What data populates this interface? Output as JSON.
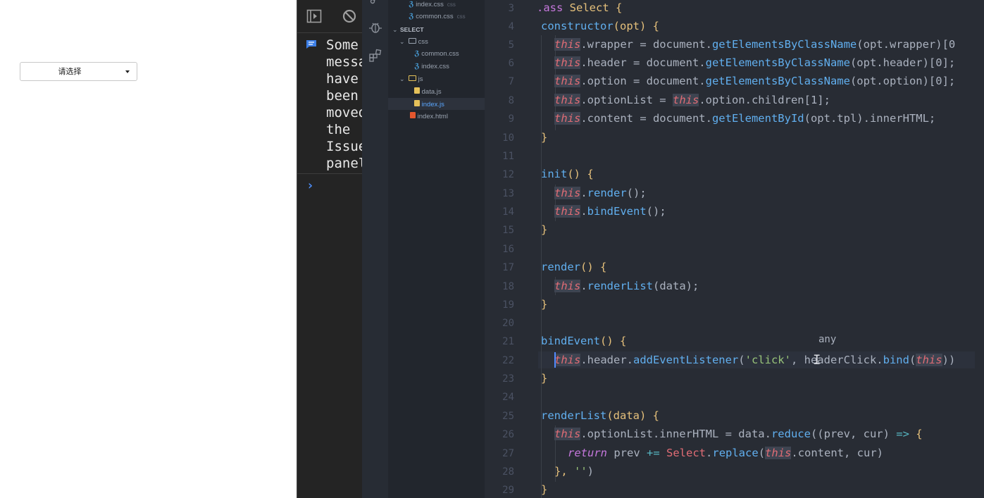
{
  "page": {
    "select": {
      "placeholder_label": "请选择"
    }
  },
  "devtools": {
    "toolbar": {
      "icons": [
        "console-sidebar-icon",
        "clear-console-icon"
      ]
    },
    "message": {
      "icon": "message-icon",
      "text": "Some messages have been moved the Issues panel"
    },
    "prompt": "›"
  },
  "explorer": {
    "rows": [
      {
        "label": "index.css",
        "sub": "css",
        "icon": "css-icon"
      },
      {
        "label": "common.css",
        "sub": "css",
        "icon": "css-icon"
      },
      {
        "label": "SELECT",
        "icon": "chevron-down-icon"
      },
      {
        "label": "css",
        "icon": "folder-icon"
      },
      {
        "label": "common.css",
        "icon": "css-icon"
      },
      {
        "label": "index.css",
        "icon": "css-icon"
      },
      {
        "label": "js",
        "icon": "folder-icon"
      },
      {
        "label": "data.js",
        "icon": "js-icon"
      },
      {
        "label": "index.js",
        "icon": "js-icon"
      },
      {
        "label": "index.html",
        "icon": "html-icon"
      }
    ]
  },
  "editor": {
    "line_numbers": [
      "3",
      "4",
      "5",
      "6",
      "7",
      "8",
      "9",
      "10",
      "11",
      "12",
      "13",
      "14",
      "15",
      "16",
      "17",
      "18",
      "19",
      "20",
      "21",
      "22",
      "23",
      "24",
      "25",
      "26",
      "27",
      "28",
      "29"
    ],
    "tooltip": "any",
    "code": {
      "l3": {
        "a": ".ass ",
        "b": "Select",
        "c": " {"
      },
      "l4": {
        "a": "constructor",
        "b": "(opt) {"
      },
      "l5": {
        "a": "this",
        "b": ".wrapper = document.",
        "c": "getElementsByClassName",
        "d": "(opt.wrapper)[0"
      },
      "l6": {
        "a": "this",
        "b": ".header = document.",
        "c": "getElementsByClassName",
        "d": "(opt.header)[0];"
      },
      "l7": {
        "a": "this",
        "b": ".option = document.",
        "c": "getElementsByClassName",
        "d": "(opt.option)[0];"
      },
      "l8": {
        "a": "this",
        "b": ".optionList = ",
        "c": "this",
        "d": ".option.children[1];"
      },
      "l9": {
        "a": "this",
        "b": ".content = document.",
        "c": "getElementById",
        "d": "(opt.tpl).innerHTML;"
      },
      "l10": {
        "a": "}"
      },
      "l12": {
        "a": "init",
        "b": "() {"
      },
      "l13": {
        "a": "this",
        "b": ".",
        "c": "render",
        "d": "();"
      },
      "l14": {
        "a": "this",
        "b": ".",
        "c": "bindEvent",
        "d": "();"
      },
      "l15": {
        "a": "}"
      },
      "l17": {
        "a": "render",
        "b": "() {"
      },
      "l18": {
        "a": "this",
        "b": ".",
        "c": "renderList",
        "d": "(data);"
      },
      "l19": {
        "a": "}"
      },
      "l21": {
        "a": "bindEvent",
        "b": "() {"
      },
      "l22": {
        "a": "this",
        "b": ".header.",
        "c": "addEventListener",
        "d": "(",
        "e": "'click'",
        "f": ", ",
        "g": "headerClick.",
        "h": "bind",
        "i": "(",
        "j": "this",
        "k": "))"
      },
      "l23": {
        "a": "}"
      },
      "l25": {
        "a": "renderList",
        "b": "(data) {"
      },
      "l26": {
        "a": "this",
        "b": ".optionList.innerHTML = data.",
        "c": "reduce",
        "d": "((prev, cur) ",
        "e": "=>",
        "f": " {"
      },
      "l27": {
        "a": "return",
        "b": " prev ",
        "c": "+=",
        "d": " ",
        "e": "Select",
        "f": ".",
        "g": "replace",
        "h": "(",
        "i": "this",
        "j": ".content, cur)"
      },
      "l28": {
        "a": "}, ",
        "b": "''",
        "c": ")"
      },
      "l29": {
        "a": "}"
      }
    }
  },
  "colors": {
    "editor_bg": "#282c34",
    "devtools_bg": "#242424",
    "keyword_this": "#e06c75",
    "function": "#61afef",
    "string": "#98c379"
  }
}
